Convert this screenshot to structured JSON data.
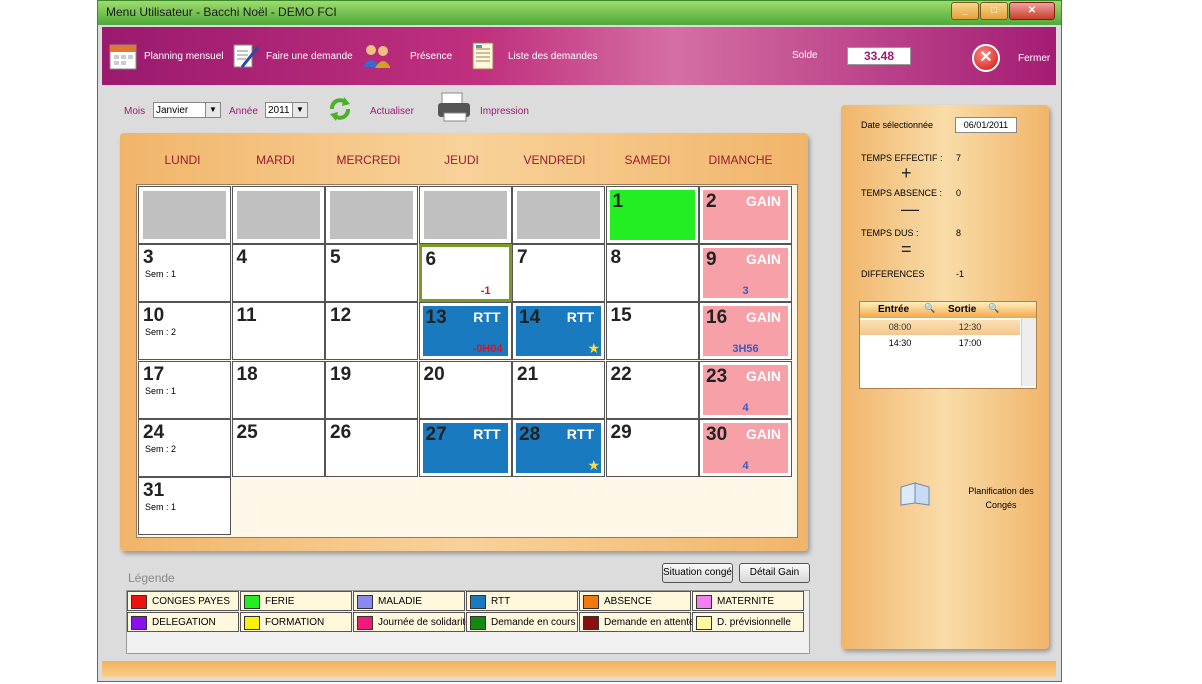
{
  "window": {
    "title": "Menu Utilisateur - Bacchi Noël - DEMO FCI"
  },
  "toolbar": {
    "items": [
      {
        "label": "Planning mensuel"
      },
      {
        "label": "Faire une demande"
      },
      {
        "label": "Présence"
      },
      {
        "label": "Liste des demandes"
      }
    ],
    "solde_label": "Solde",
    "solde_value": "33.48",
    "close_label": "Fermer"
  },
  "filters": {
    "mois_label": "Mois",
    "mois_value": "Janvier",
    "annee_label": "Année",
    "annee_value": "2011",
    "refresh_label": "Actualiser",
    "print_label": "Impression"
  },
  "calendar": {
    "days": [
      "LUNDI",
      "MARDI",
      "MERCREDI",
      "JEUDI",
      "VENDREDI",
      "SAMEDI",
      "DIMANCHE"
    ],
    "weeks": [
      [
        {
          "blank": true
        },
        {
          "blank": true
        },
        {
          "blank": true
        },
        {
          "blank": true
        },
        {
          "blank": true
        },
        {
          "num": "1",
          "type": "ferie"
        },
        {
          "num": "2",
          "type": "gain",
          "code": "GAIN"
        }
      ],
      [
        {
          "num": "3",
          "sem": "Sem : 1"
        },
        {
          "num": "4"
        },
        {
          "num": "5"
        },
        {
          "num": "6",
          "selected": true,
          "sub": "-1"
        },
        {
          "num": "7"
        },
        {
          "num": "8"
        },
        {
          "num": "9",
          "type": "gain",
          "code": "GAIN",
          "sub": "3"
        }
      ],
      [
        {
          "num": "10",
          "sem": "Sem : 2"
        },
        {
          "num": "11"
        },
        {
          "num": "12"
        },
        {
          "num": "13",
          "type": "rtt",
          "code": "RTT",
          "sub": "-0H04"
        },
        {
          "num": "14",
          "type": "rtt",
          "code": "RTT",
          "star": true
        },
        {
          "num": "15"
        },
        {
          "num": "16",
          "type": "gain",
          "code": "GAIN",
          "sub": "3H56"
        }
      ],
      [
        {
          "num": "17",
          "sem": "Sem : 1"
        },
        {
          "num": "18"
        },
        {
          "num": "19"
        },
        {
          "num": "20"
        },
        {
          "num": "21"
        },
        {
          "num": "22"
        },
        {
          "num": "23",
          "type": "gain",
          "code": "GAIN",
          "sub": "4"
        }
      ],
      [
        {
          "num": "24",
          "sem": "Sem : 2"
        },
        {
          "num": "25"
        },
        {
          "num": "26"
        },
        {
          "num": "27",
          "type": "rtt",
          "code": "RTT"
        },
        {
          "num": "28",
          "type": "rtt",
          "code": "RTT",
          "star": true
        },
        {
          "num": "29"
        },
        {
          "num": "30",
          "type": "gain",
          "code": "GAIN",
          "sub": "4"
        }
      ],
      [
        {
          "num": "31",
          "sem": "Sem : 1"
        }
      ]
    ]
  },
  "legend": {
    "title": "Légende",
    "items": [
      {
        "label": "CONGES PAYES",
        "color": "#ee1111"
      },
      {
        "label": "FERIE",
        "color": "#22ee22"
      },
      {
        "label": "MALADIE",
        "color": "#8a8aee"
      },
      {
        "label": "RTT",
        "color": "#1a7ac0"
      },
      {
        "label": "ABSENCE",
        "color": "#f07a10"
      },
      {
        "label": "MATERNITE",
        "color": "#f080f0"
      },
      {
        "label": "DELEGATION",
        "color": "#8a10ee"
      },
      {
        "label": "FORMATION",
        "color": "#f8f010"
      },
      {
        "label": "Journée de solidarité",
        "color": "#f01a7a"
      },
      {
        "label": "Demande en cours",
        "color": "#128a12"
      },
      {
        "label": "Demande  en attente",
        "color": "#8a1010"
      },
      {
        "label": "D. prévisionnelle",
        "color": "#fff8a0"
      }
    ]
  },
  "buttons": {
    "situation": "Situation congé",
    "detail": "Détail Gain"
  },
  "details": {
    "date_label": "Date sélectionnée",
    "date_value": "06/01/2011",
    "temps_effectif_label": "TEMPS EFFECTIF :",
    "temps_effectif_value": "7",
    "plus": "+",
    "temps_absence_label": "TEMPS ABSENCE :",
    "temps_absence_value": "0",
    "minus": "—",
    "temps_dus_label": "TEMPS DUS :",
    "temps_dus_value": "8",
    "equals": "=",
    "differences_label": "DIFFERENCES",
    "differences_value": "-1",
    "table": {
      "headers": [
        "Entrée",
        "Sortie"
      ],
      "rows": [
        [
          "08:00",
          "12:30"
        ],
        [
          "14:30",
          "17:00"
        ]
      ]
    },
    "planif_label": "Planification des Congés"
  },
  "colors": {
    "gain_bg": "#f8a0a8",
    "rtt_bg": "#1a7ac0",
    "ferie_bg": "#22ee22",
    "accent": "#9a1a6e"
  }
}
